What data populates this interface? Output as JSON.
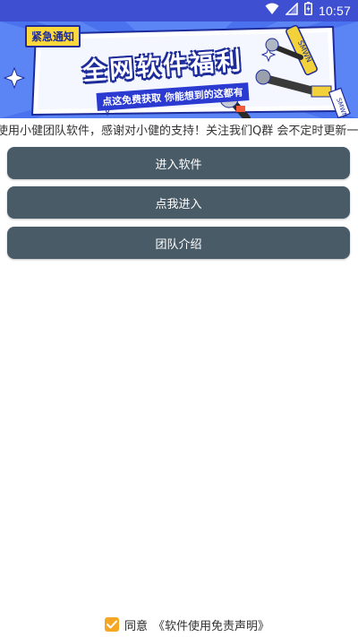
{
  "status_bar": {
    "time": "10:57",
    "colors": {
      "background": "#3f4fd1",
      "foreground": "#ffffff"
    }
  },
  "banner": {
    "badge": "紧急通知",
    "title": "全网软件福利",
    "subtitle": "点这免费获取 你能想到的这都有",
    "mic_labels": [
      "SMWN",
      "SMWN",
      "SMWN"
    ]
  },
  "marquee": {
    "text": "使用小健团队软件，感谢对小健的支持！关注我们Q群 会不定时更新一些好"
  },
  "menu": {
    "items": [
      {
        "label": "进入软件"
      },
      {
        "label": "点我进入"
      },
      {
        "label": "团队介绍"
      }
    ],
    "button_color": "#4a5b68"
  },
  "agreement": {
    "checked": true,
    "agree_label": "同意",
    "link_label": "《软件使用免责声明》",
    "checkbox_color": "#f5a623"
  }
}
